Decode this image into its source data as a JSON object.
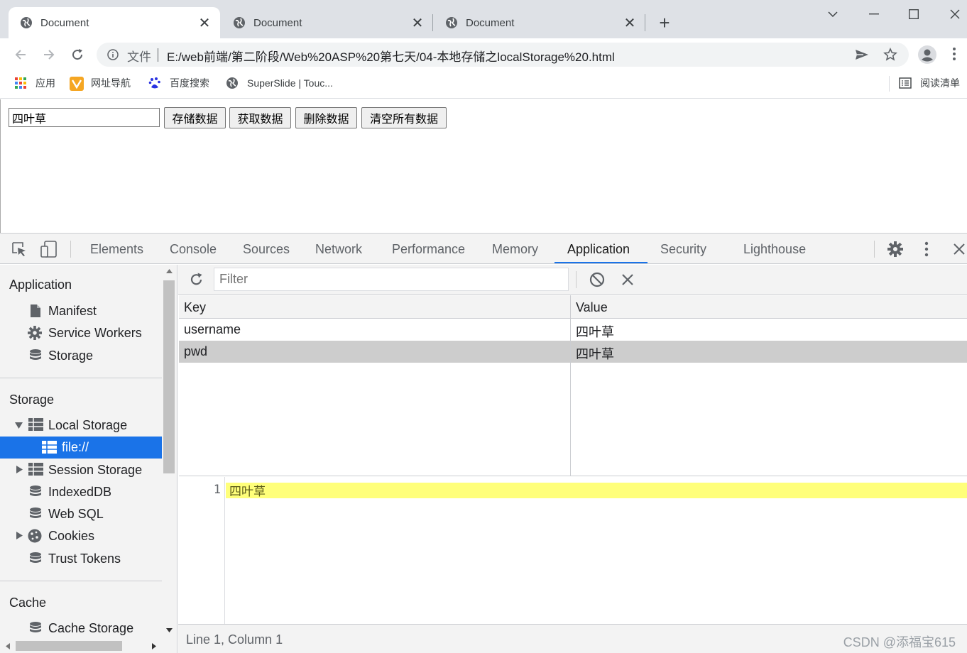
{
  "browser": {
    "tabs": [
      {
        "title": "Document",
        "active": true
      },
      {
        "title": "Document",
        "active": false
      },
      {
        "title": "Document",
        "active": false
      }
    ],
    "address": {
      "scheme_label": "文件",
      "url": "E:/web前端/第二阶段/Web%20ASP%20第七天/04-本地存储之localStorage%20.html"
    },
    "bookmarks": [
      {
        "label": "应用",
        "icon": "apps-grid-icon"
      },
      {
        "label": "网址导航",
        "icon": "nav-bookmark-icon"
      },
      {
        "label": "百度搜索",
        "icon": "baidu-paw-icon"
      },
      {
        "label": "SuperSlide | Touc...",
        "icon": "globe-icon"
      }
    ],
    "reading_list": "阅读清单"
  },
  "page": {
    "input_value": "四叶草",
    "buttons": [
      "存储数据",
      "获取数据",
      "删除数据",
      "清空所有数据"
    ]
  },
  "devtools": {
    "tabs": [
      "Elements",
      "Console",
      "Sources",
      "Network",
      "Performance",
      "Memory",
      "Application",
      "Security",
      "Lighthouse"
    ],
    "selected_tab": "Application",
    "sidebar": {
      "application_title": "Application",
      "application_items": [
        "Manifest",
        "Service Workers",
        "Storage"
      ],
      "storage_title": "Storage",
      "storage_items": [
        "Local Storage",
        "file://",
        "Session Storage",
        "IndexedDB",
        "Web SQL",
        "Cookies",
        "Trust Tokens"
      ],
      "cache_title": "Cache",
      "cache_items": [
        "Cache Storage"
      ]
    },
    "filter_placeholder": "Filter",
    "grid": {
      "headers": [
        "Key",
        "Value"
      ],
      "rows": [
        {
          "key": "username",
          "value": "四叶草",
          "selected": false
        },
        {
          "key": "pwd",
          "value": "四叶草",
          "selected": true
        }
      ]
    },
    "preview": {
      "line_number": "1",
      "text": "四叶草"
    },
    "status": "Line 1, Column 1"
  },
  "watermark": "CSDN @添福宝615",
  "colors": {
    "accent": "#1a73e8",
    "highlight": "#ffff7a",
    "selected_row": "#cdcdcd"
  }
}
